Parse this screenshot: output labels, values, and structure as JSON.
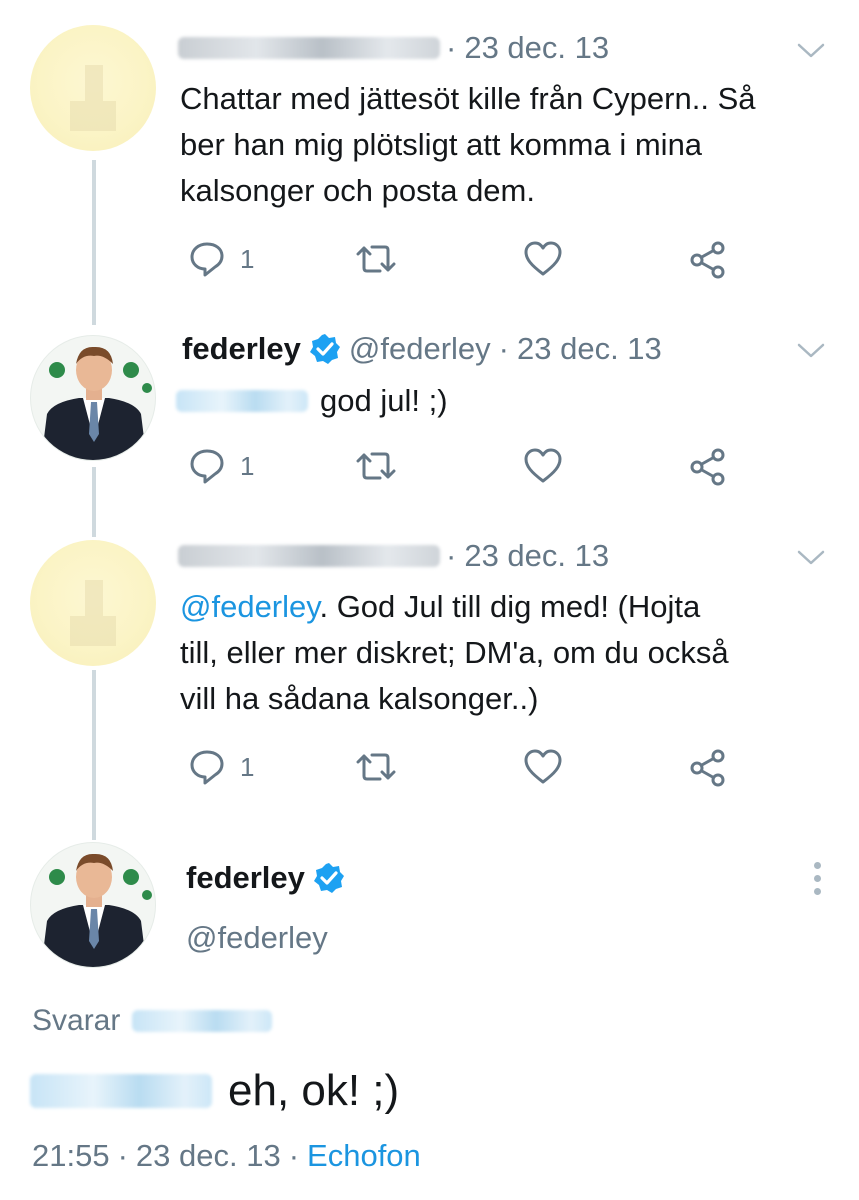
{
  "tweets": [
    {
      "date": "23 dec. 13",
      "text": "Chattar med jättesöt kille från Cypern.. Så ber han mig plötsligt att komma i mina kalsonger och posta dem.",
      "reply_count": "1"
    },
    {
      "name": "federley",
      "handle": "@federley",
      "date": "23 dec. 13",
      "text": "god jul! ;)",
      "reply_count": "1"
    },
    {
      "date": "23 dec. 13",
      "mention": "@federley",
      "text_line1": ". God Jul till dig med! (Hojta",
      "text_line2": "till, eller mer diskret; DM'a, om du också",
      "text_line3": "vill ha sådana kalsonger..)",
      "reply_count": "1"
    }
  ],
  "main": {
    "name": "federley",
    "handle": "@federley",
    "replying_label": "Svarar",
    "text": "eh, ok! ;)",
    "time": "21:55",
    "date": "23 dec. 13",
    "source": "Echofon"
  },
  "separator": "·",
  "colors": {
    "link": "#1b95e0",
    "muted": "#657786",
    "verified": "#1da1f2"
  },
  "icons": [
    "reply-icon",
    "retweet-icon",
    "like-icon",
    "share-icon",
    "chevron-down-icon",
    "verified-badge-icon",
    "more-icon"
  ]
}
